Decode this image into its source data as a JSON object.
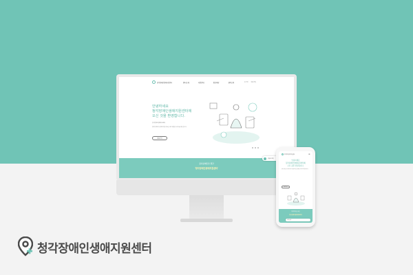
{
  "brand": {
    "name": "청각장애인생애지원센터",
    "accent": "#70c4b6",
    "icon": "location-pin-plus-icon"
  },
  "desktop": {
    "logo_text": "청각장애인생애지원센터",
    "nav": [
      "센터소개",
      "사업안내",
      "정보마당",
      "참여소통"
    ],
    "util": [
      "로그인",
      "회원가입"
    ],
    "hero_title": [
      "안녕하세요",
      "청각장애인생애지원센터에",
      "오신 것을 환영합니다."
    ],
    "hero_sub": "청각장애인생애지원센터",
    "hero_desc": "청각장애인의 생애주기별 지원을 위한 맞춤형 서비스를 제공합니다.",
    "hero_button": "바로가기",
    "band_line1": "청각장애인을 위한",
    "band_line2": "'청각장애인생애지원센터'",
    "float_widget": "상담원 연결"
  },
  "mobile": {
    "logo_text": "청각장애인생애지원센터",
    "menu_icon": "hamburger-menu-icon",
    "hero_title": [
      "안녕하세요",
      "청각장애인생애지원센터에",
      "오신 것을 환영합니다."
    ],
    "hero_desc": "청각장애인의 생애주기별 지원을 위한 맞춤형 서비스를 제공합니다.",
    "hero_button": "바로가기",
    "band_line1": "청각장애인을 위한",
    "band_line2": "'청각장애인생애지원센터'",
    "float_widget": "상담원 연결"
  }
}
